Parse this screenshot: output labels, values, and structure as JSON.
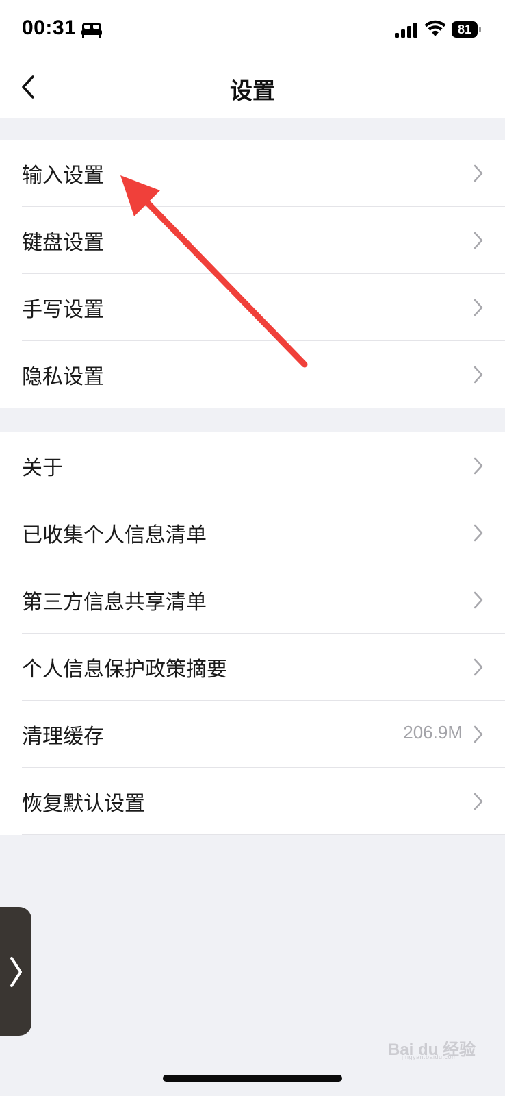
{
  "status_bar": {
    "time": "00:31",
    "battery": "81",
    "icons": [
      "bed-icon",
      "signal-icon",
      "wifi-icon",
      "battery-icon"
    ]
  },
  "nav": {
    "title": "设置",
    "back_icon": "chevron-left-icon"
  },
  "groups": [
    {
      "items": [
        {
          "label": "输入设置"
        },
        {
          "label": "键盘设置"
        },
        {
          "label": "手写设置"
        },
        {
          "label": "隐私设置"
        }
      ]
    },
    {
      "items": [
        {
          "label": "关于"
        },
        {
          "label": "已收集个人信息清单"
        },
        {
          "label": "第三方信息共享清单"
        },
        {
          "label": "个人信息保护政策摘要"
        },
        {
          "label": "清理缓存",
          "value": "206.9M"
        },
        {
          "label": "恢复默认设置"
        }
      ]
    }
  ],
  "annotation": {
    "color": "#f0403a",
    "target": "输入设置"
  },
  "watermark": {
    "text": "Bai du 经验",
    "sub": "jingyan.baidu.com"
  },
  "colors": {
    "background": "#f0f1f5",
    "card": "#ffffff",
    "text": "#1a1a1a",
    "secondary": "#a3a3a8"
  }
}
